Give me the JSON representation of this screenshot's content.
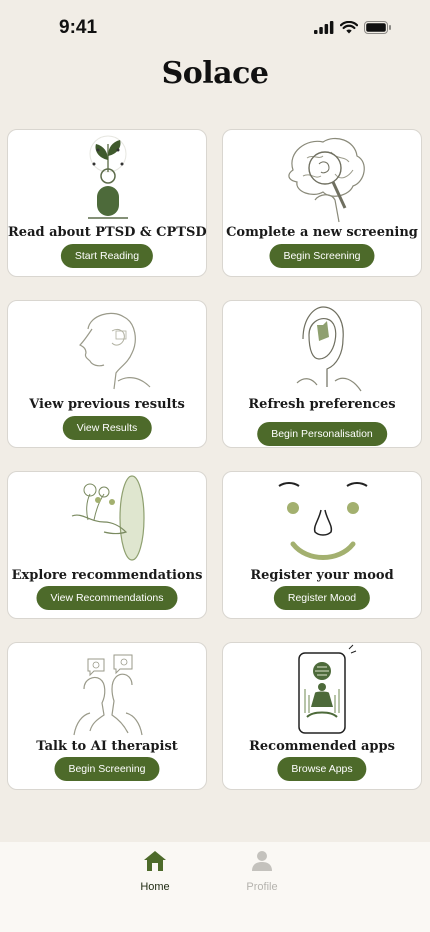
{
  "status_bar": {
    "time": "9:41"
  },
  "app": {
    "title": "Solace"
  },
  "cards": [
    {
      "title": "Read about PTSD & CPTSD",
      "button": "Start Reading"
    },
    {
      "title": "Complete a new screening",
      "button": "Begin Screening"
    },
    {
      "title": "View previous results",
      "button": "View Results"
    },
    {
      "title": "Refresh preferences",
      "button": "Begin Personalisation"
    },
    {
      "title": "Explore recommendations",
      "button": "View Recommendations"
    },
    {
      "title": "Register your mood",
      "button": "Register Mood"
    },
    {
      "title": "Talk to AI therapist",
      "button": "Begin Screening"
    },
    {
      "title": "Recommended apps",
      "button": "Browse Apps"
    }
  ],
  "tab_bar": {
    "tabs": [
      {
        "label": "Home",
        "icon": "home-icon",
        "active": true
      },
      {
        "label": "Profile",
        "icon": "person-icon",
        "active": false
      }
    ]
  },
  "colors": {
    "accent": "#4d6a2a",
    "background": "#f1ede6",
    "card": "#ffffff",
    "illustration_line": "#6f7d5c",
    "mood_face": "#a3b06f"
  }
}
